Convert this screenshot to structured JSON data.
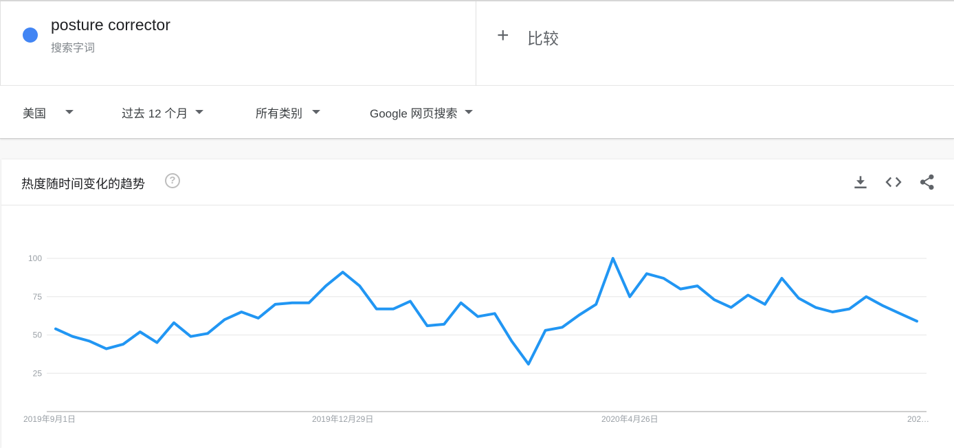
{
  "search_term": {
    "name": "posture corrector",
    "type": "搜索字词",
    "color": "#4285f4"
  },
  "compare": {
    "plus": "+",
    "label": "比较"
  },
  "filters": [
    {
      "label": "美国"
    },
    {
      "label": "过去 12 个月"
    },
    {
      "label": "所有类别"
    },
    {
      "label": "Google 网页搜索"
    }
  ],
  "card": {
    "title": "热度随时间变化的趋势",
    "help_glyph": "?",
    "icons": [
      "download-icon",
      "embed-code-icon",
      "share-icon"
    ]
  },
  "chart_data": {
    "type": "line",
    "ylim": [
      0,
      100
    ],
    "yticks": [
      25,
      50,
      75,
      100
    ],
    "x_tick_labels": [
      {
        "label": "2019年9月1日",
        "index": 0
      },
      {
        "label": "2019年12月29日",
        "index": 17
      },
      {
        "label": "2020年4月26日",
        "index": 34
      },
      {
        "label": "202…",
        "index": 51
      }
    ],
    "grid": true,
    "line_color": "#2196f3",
    "series": [
      {
        "values": [
          54,
          49,
          46,
          41,
          44,
          52,
          45,
          58,
          49,
          51,
          60,
          65,
          61,
          70,
          71,
          71,
          82,
          91,
          82,
          67,
          67,
          72,
          56,
          57,
          71,
          62,
          64,
          46,
          31,
          53,
          55,
          63,
          70,
          100,
          75,
          90,
          87,
          80,
          82,
          73,
          68,
          76,
          70,
          87,
          74,
          68,
          65,
          67,
          75,
          69,
          64,
          59
        ]
      }
    ]
  }
}
